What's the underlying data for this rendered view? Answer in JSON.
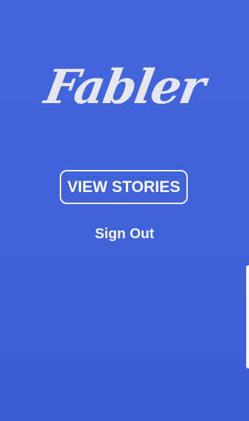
{
  "app": {
    "logo_text": "Fabler"
  },
  "actions": {
    "view_stories_label": "VIEW STORIES",
    "sign_out_label": "Sign Out"
  },
  "theme": {
    "background": "#3f62d9",
    "button_border": "#f2f4ff",
    "text": "#ffffff"
  }
}
